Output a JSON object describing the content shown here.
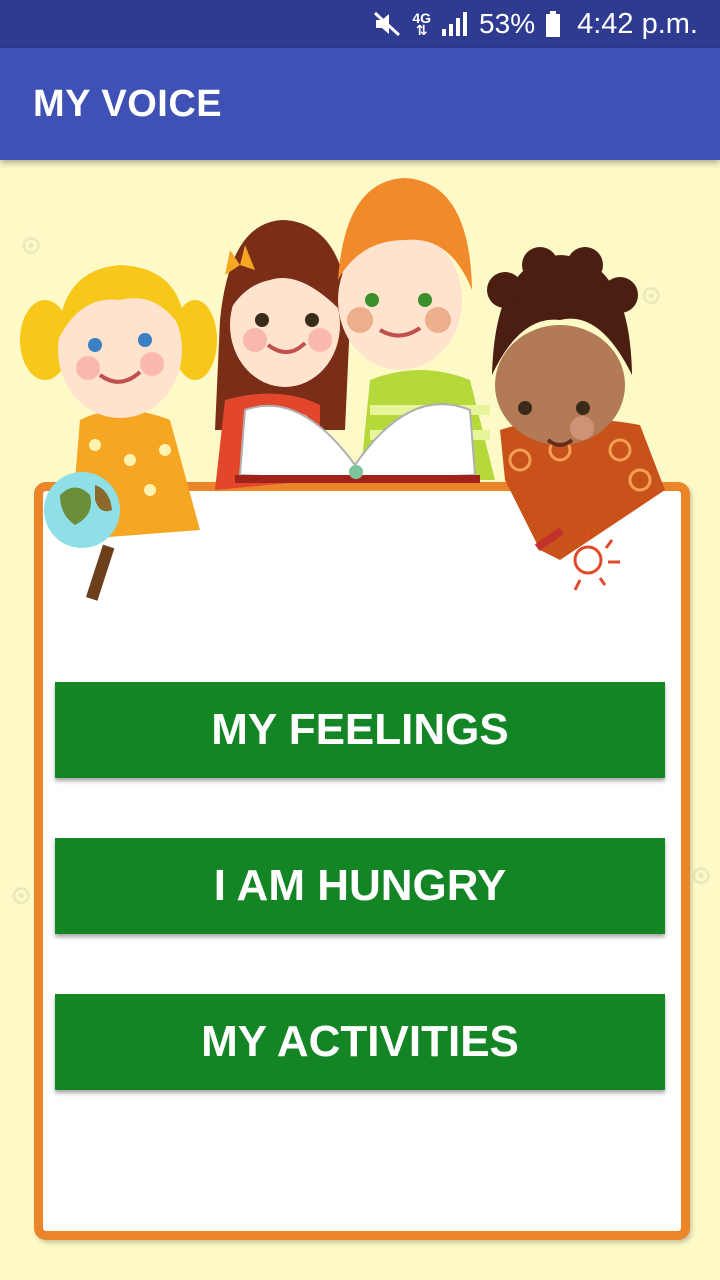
{
  "status_bar": {
    "network_top": "4G",
    "network_bottom": "⇅",
    "battery_percent": "53%",
    "time": "4:42 p.m.",
    "icons": [
      "mute-icon",
      "network-4g-icon",
      "signal-icon",
      "battery-icon"
    ]
  },
  "app_bar": {
    "title": "MY VOICE"
  },
  "menu": {
    "buttons": [
      {
        "label": "MY FEELINGS"
      },
      {
        "label": "I AM HUNGRY"
      },
      {
        "label": "MY ACTIVITIES"
      }
    ]
  },
  "colors": {
    "status_bar": "#2e3b91",
    "app_bar": "#3f51b5",
    "background": "#fdfac8",
    "board_frame": "#ec8429",
    "button": "#138525"
  }
}
